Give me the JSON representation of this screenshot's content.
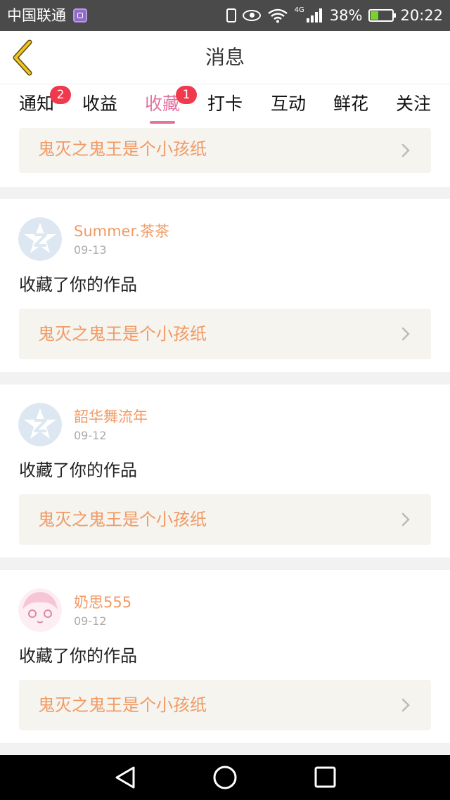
{
  "status_bar": {
    "carrier": "中国联通",
    "network": "4G",
    "battery_percent": "38%",
    "time": "20:22",
    "icons": [
      "app-notification-icon",
      "vibrate-icon",
      "eye-comfort-icon",
      "wifi-icon",
      "signal-icon",
      "battery-charging-icon"
    ]
  },
  "header": {
    "title": "消息",
    "back_icon": "chevron-left-icon",
    "accent_color": "#f0c420"
  },
  "tabs": [
    {
      "label": "通知",
      "badge": "2",
      "active": false
    },
    {
      "label": "收益",
      "badge": null,
      "active": false
    },
    {
      "label": "收藏",
      "badge": "1",
      "active": true
    },
    {
      "label": "打卡",
      "badge": null,
      "active": false
    },
    {
      "label": "互动",
      "badge": null,
      "active": false
    },
    {
      "label": "鲜花",
      "badge": null,
      "active": false
    },
    {
      "label": "关注",
      "badge": null,
      "active": false
    }
  ],
  "colors": {
    "tab_active": "#e2739f",
    "badge": "#f0394d",
    "username": "#f19a64",
    "work_title": "#f19a64",
    "card_bg": "#f5f4ef"
  },
  "partial_card": {
    "work_title": "鬼灭之鬼王是个小孩纸"
  },
  "messages": [
    {
      "username": "Summer.茶茶",
      "date": "09-13",
      "text": "收藏了你的作品",
      "work_title": "鬼灭之鬼王是个小孩纸",
      "avatar": "default-avatar-icon"
    },
    {
      "username": "韶华舞流年",
      "date": "09-12",
      "text": "收藏了你的作品",
      "work_title": "鬼灭之鬼王是个小孩纸",
      "avatar": "default-avatar-icon"
    },
    {
      "username": "奶思555",
      "date": "09-12",
      "text": "收藏了你的作品",
      "work_title": "鬼灭之鬼王是个小孩纸",
      "avatar": "anime-avatar"
    }
  ],
  "nav_bar": {
    "icons": [
      "back-triangle-icon",
      "home-circle-icon",
      "recents-square-icon"
    ]
  }
}
